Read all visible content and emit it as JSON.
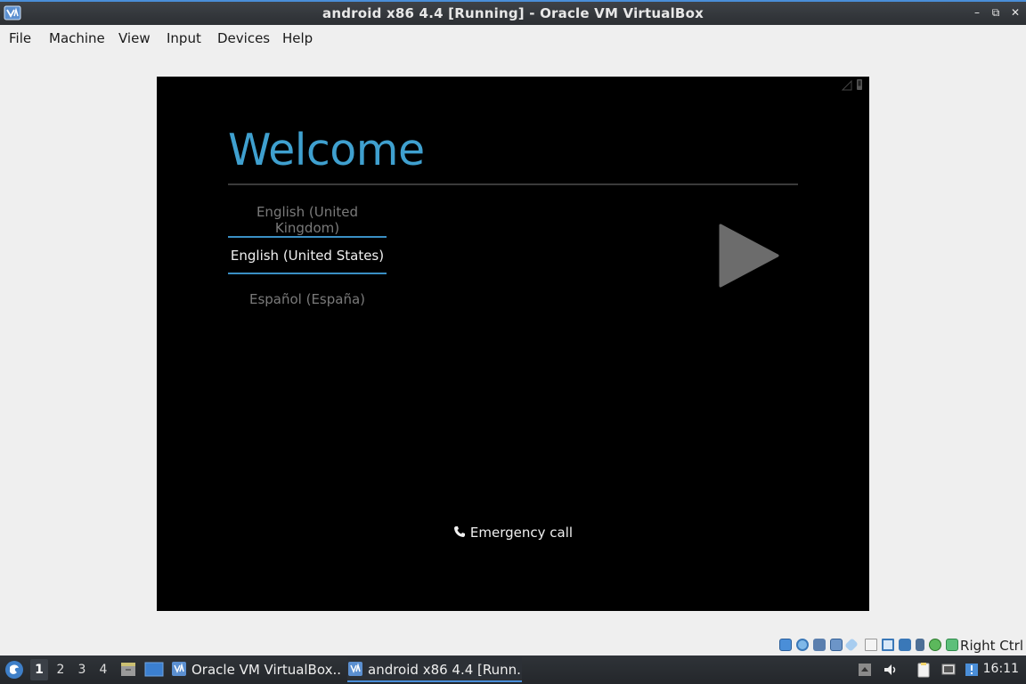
{
  "window": {
    "title": "android x86 4.4 [Running] - Oracle VM VirtualBox",
    "minimize_label": "–",
    "restore_label": "⧉",
    "close_label": "✕"
  },
  "menubar": {
    "items": [
      {
        "label": "File"
      },
      {
        "label": "Machine"
      },
      {
        "label": "View"
      },
      {
        "label": "Input"
      },
      {
        "label": "Devices"
      },
      {
        "label": "Help"
      }
    ]
  },
  "android": {
    "welcome": "Welcome",
    "languages": [
      {
        "label": "English (United Kingdom)",
        "selected": false
      },
      {
        "label": "English (United States)",
        "selected": true
      },
      {
        "label": "Español (España)",
        "selected": false
      }
    ],
    "emergency_call": "Emergency call",
    "accent_color": "#3fa0cf"
  },
  "vbox_status": {
    "icons": [
      "hard-disk-icon",
      "optical-disk-icon",
      "audio-icon",
      "network-icon",
      "usb-icon",
      "shared-folders-icon",
      "display-icon",
      "video-capture-icon",
      "cpu-icon",
      "mouse-integration-icon",
      "keyboard-capture-icon"
    ],
    "host_key": "Right Ctrl"
  },
  "taskbar": {
    "workspaces": [
      "1",
      "2",
      "3",
      "4"
    ],
    "active_workspace": "1",
    "tasks": [
      {
        "label": "Oracle VM VirtualBox...",
        "active": false
      },
      {
        "label": "android x86 4.4 [Runn...",
        "active": true
      }
    ],
    "clock": "16:11"
  }
}
